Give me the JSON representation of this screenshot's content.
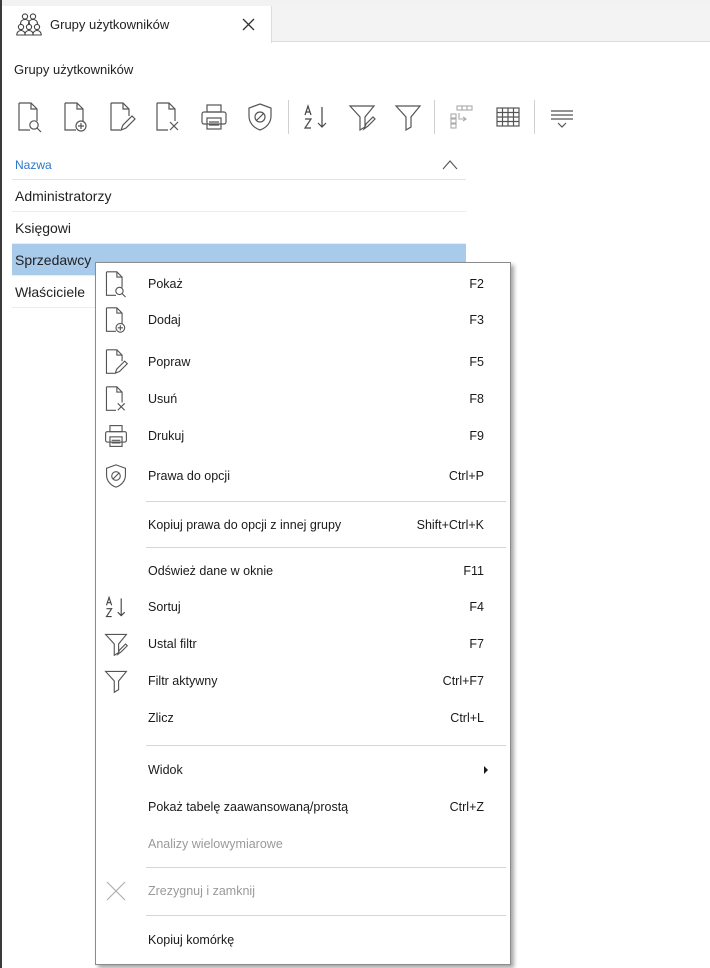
{
  "tab": {
    "title": "Grupy użytkowników",
    "icon": "user-group-icon"
  },
  "page_label": "Grupy użytkowników",
  "toolbar": [
    {
      "name": "view-button",
      "icon": "document-view-icon"
    },
    {
      "name": "add-button",
      "icon": "document-add-icon"
    },
    {
      "name": "edit-button",
      "icon": "document-edit-icon"
    },
    {
      "name": "delete-button",
      "icon": "document-delete-icon"
    },
    {
      "name": "print-button",
      "icon": "printer-icon"
    },
    {
      "name": "permissions-button",
      "icon": "shield-icon"
    },
    {
      "name": "sort-button",
      "icon": "sort-az-icon"
    },
    {
      "name": "set-filter-button",
      "icon": "filter-edit-icon"
    },
    {
      "name": "active-filter-button",
      "icon": "filter-icon"
    },
    {
      "name": "grouping-button",
      "icon": "grouping-icon"
    },
    {
      "name": "table-button",
      "icon": "table-grid-icon"
    },
    {
      "name": "more-button",
      "icon": "lines-menu-icon"
    }
  ],
  "grid": {
    "column": "Nazwa",
    "rows": [
      "Administratorzy",
      "Księgowi",
      "Sprzedawcy",
      "Właściciele"
    ],
    "selected_index": 2
  },
  "context_menu": {
    "items": [
      {
        "label": "Pokaż",
        "shortcut": "F2",
        "icon": "document-view-icon"
      },
      {
        "label": "Dodaj",
        "shortcut": "F3",
        "icon": "document-add-icon"
      },
      {
        "label": "Popraw",
        "shortcut": "F5",
        "icon": "document-edit-icon"
      },
      {
        "label": "Usuń",
        "shortcut": "F8",
        "icon": "document-delete-icon"
      },
      {
        "label": "Drukuj",
        "shortcut": "F9",
        "icon": "printer-icon"
      },
      {
        "label": "Prawa do opcji",
        "shortcut": "Ctrl+P",
        "icon": "shield-icon"
      },
      {
        "label": "Kopiuj prawa do opcji z innej grupy",
        "shortcut": "Shift+Ctrl+K"
      },
      {
        "label": "Odśwież dane w oknie",
        "shortcut": "F11"
      },
      {
        "label": "Sortuj",
        "shortcut": "F4",
        "icon": "sort-az-icon"
      },
      {
        "label": "Ustal filtr",
        "shortcut": "F7",
        "icon": "filter-edit-icon"
      },
      {
        "label": "Filtr aktywny",
        "shortcut": "Ctrl+F7",
        "icon": "filter-icon"
      },
      {
        "label": "Zlicz",
        "shortcut": "Ctrl+L"
      },
      {
        "label": "Widok",
        "submenu": true
      },
      {
        "label": "Pokaż tabelę zaawansowaną/prostą",
        "shortcut": "Ctrl+Z"
      },
      {
        "label": "Analizy wielowymiarowe",
        "disabled": true
      },
      {
        "label": "Zrezygnuj i zamknij",
        "disabled": true,
        "icon": "close-x-icon"
      },
      {
        "label": "Kopiuj komórkę"
      }
    ]
  }
}
